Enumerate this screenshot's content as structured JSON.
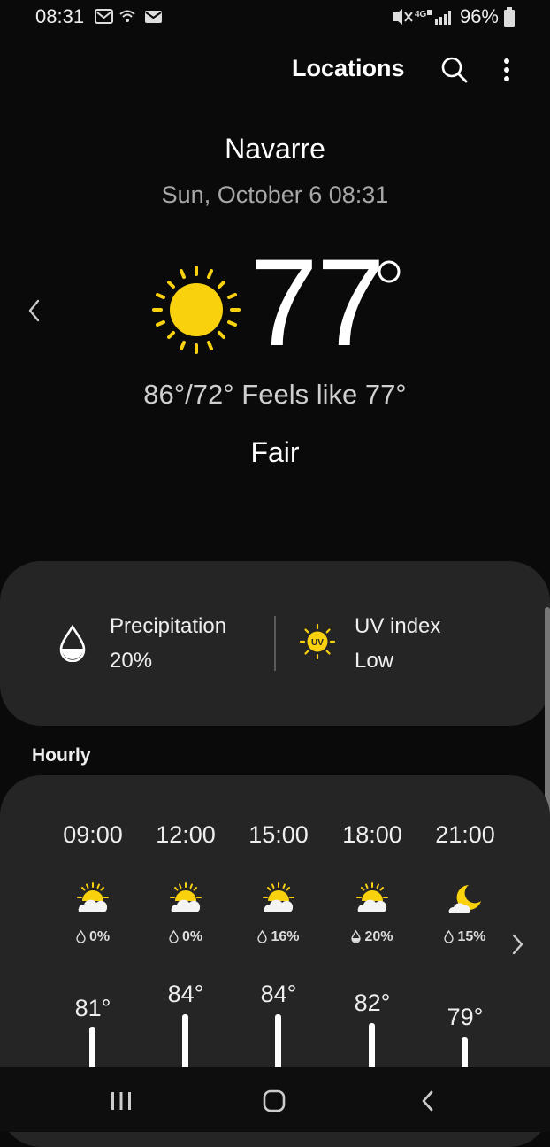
{
  "status_bar": {
    "time": "08:31",
    "battery": "96%"
  },
  "header": {
    "title": "Locations"
  },
  "location": {
    "city": "Navarre",
    "datetime": "Sun, October 6 08:31",
    "temperature": "77",
    "high_low_feels": "86°/72° Feels like 77°",
    "condition": "Fair"
  },
  "details": {
    "precipitation_label": "Precipitation",
    "precipitation_value": "20%",
    "uv_label": "UV index",
    "uv_value": "Low",
    "uv_icon_text": "UV"
  },
  "hourly": {
    "title": "Hourly",
    "items": [
      {
        "time": "09:00",
        "rain": "0%",
        "temp": "81°",
        "icon": "partly-sunny-icon"
      },
      {
        "time": "12:00",
        "rain": "0%",
        "temp": "84°",
        "icon": "partly-sunny-icon"
      },
      {
        "time": "15:00",
        "rain": "16%",
        "temp": "84°",
        "icon": "partly-sunny-icon"
      },
      {
        "time": "18:00",
        "rain": "20%",
        "temp": "82°",
        "icon": "partly-sunny-icon"
      },
      {
        "time": "21:00",
        "rain": "15%",
        "temp": "79°",
        "icon": "moon-cloud-icon"
      }
    ]
  },
  "colors": {
    "accent_sun": "#f9d10d",
    "background": "#0a0a0a",
    "card": "#252525"
  }
}
